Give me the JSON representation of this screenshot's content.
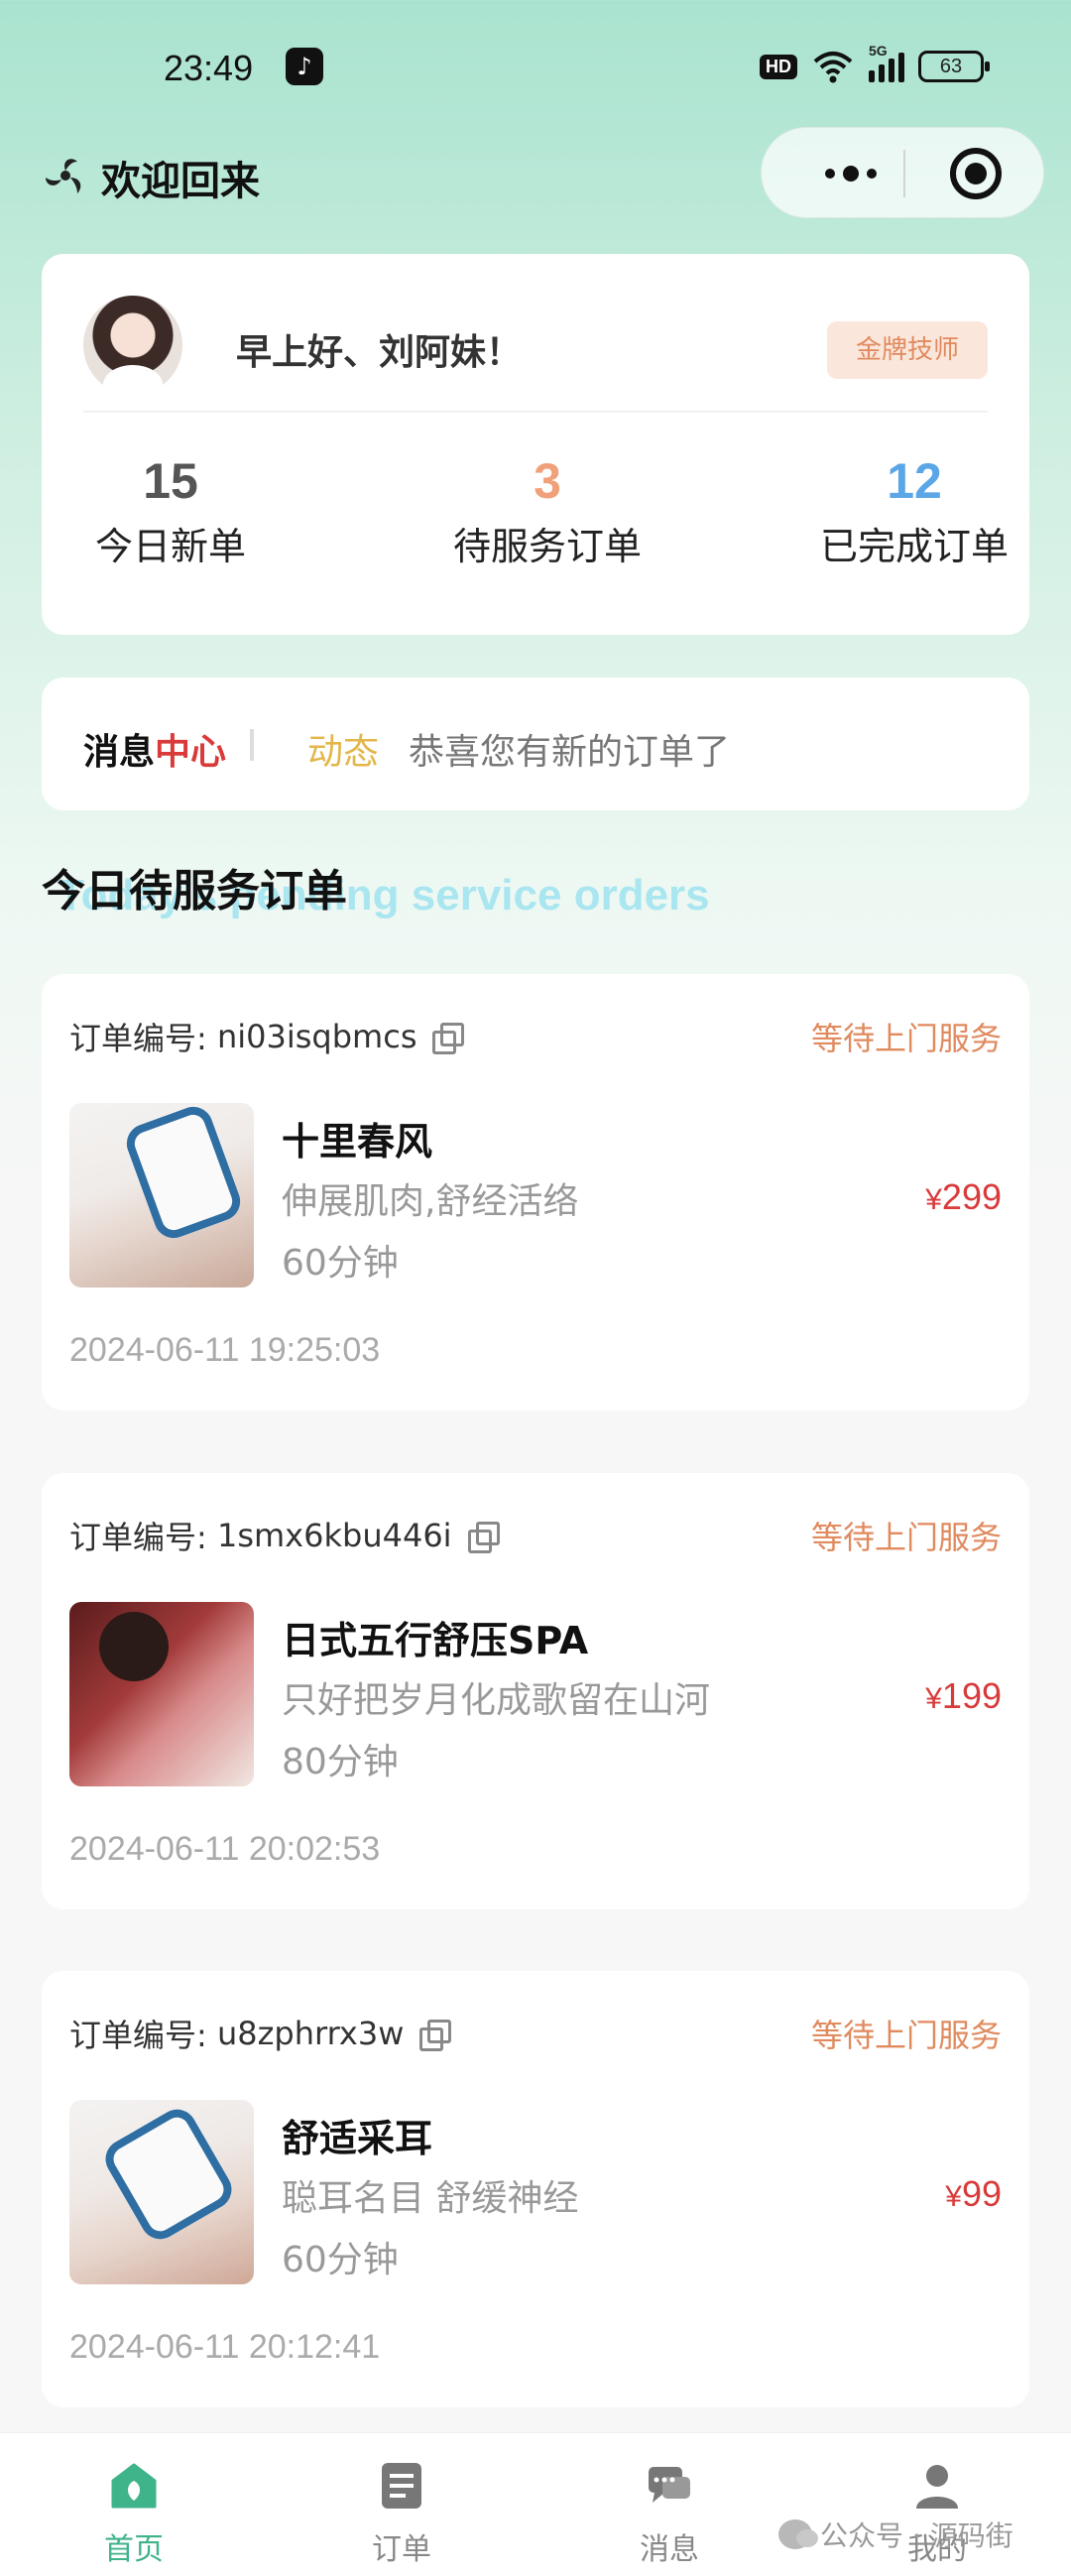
{
  "status_bar": {
    "time": "23:49",
    "hd_label": "HD",
    "network_label": "5G",
    "battery": "63"
  },
  "header": {
    "title": "欢迎回来"
  },
  "profile": {
    "greeting": "早上好、刘阿妹！",
    "badge": "金牌技师",
    "stats": [
      {
        "value": "15",
        "label": "今日新单",
        "color": "#555555"
      },
      {
        "value": "3",
        "label": "待服务订单",
        "color": "#f0a07a"
      },
      {
        "value": "12",
        "label": "已完成订单",
        "color": "#5aa6e6"
      }
    ]
  },
  "message_center": {
    "title_part1": "消息",
    "title_part2": "中心",
    "tag": "动态",
    "text": "恭喜您有新的订单了"
  },
  "section": {
    "title": "今日待服务订单",
    "subtitle": "Today's pending service orders"
  },
  "orders": [
    {
      "order_label": "订单编号:",
      "order_no": "ni03isqbmcs",
      "status": "等待上门服务",
      "name": "十里春风",
      "desc": "伸展肌肉,舒经活络",
      "duration": "60分钟",
      "currency": "¥",
      "price": "299",
      "time": "2024-06-11 19:25:03"
    },
    {
      "order_label": "订单编号:",
      "order_no": "1smx6kbu446i",
      "status": "等待上门服务",
      "name": "日式五行舒压SPA",
      "desc": "只好把岁月化成歌留在山河",
      "duration": "80分钟",
      "currency": "¥",
      "price": "199",
      "time": "2024-06-11 20:02:53"
    },
    {
      "order_label": "订单编号:",
      "order_no": "u8zphrrx3w",
      "status": "等待上门服务",
      "name": "舒适采耳",
      "desc": "聪耳名目 舒缓神经",
      "duration": "60分钟",
      "currency": "¥",
      "price": "99",
      "time": "2024-06-11 20:12:41"
    }
  ],
  "bottom_nav": [
    {
      "label": "首页",
      "icon": "home-icon",
      "active": true
    },
    {
      "label": "订单",
      "icon": "orders-icon",
      "active": false
    },
    {
      "label": "消息",
      "icon": "message-icon",
      "active": false
    },
    {
      "label": "我的",
      "icon": "profile-icon",
      "active": false
    }
  ],
  "watermark": "公众号 · 源码街",
  "colors": {
    "accent": "#3fb389",
    "price": "#d93a3a",
    "status": "#e08a5e"
  }
}
